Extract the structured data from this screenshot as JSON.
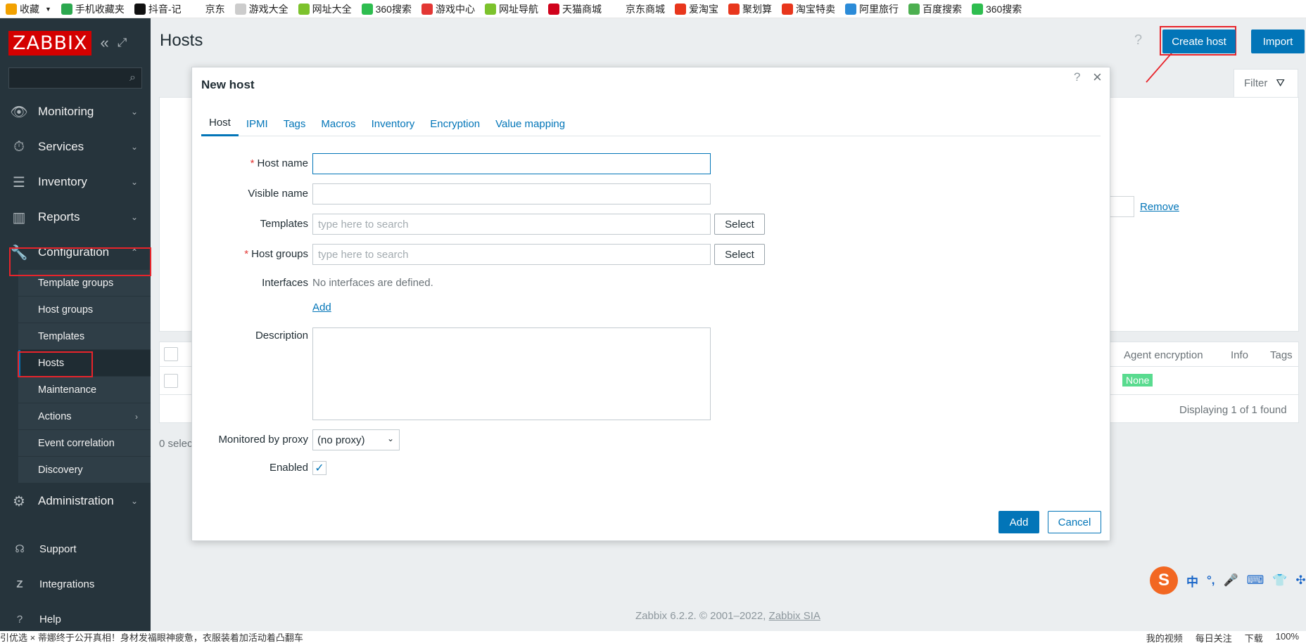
{
  "bookmarks": [
    {
      "label": "收藏",
      "icon": "star-icon",
      "color": "#f2a100"
    },
    {
      "label": "手机收藏夹",
      "icon": "phone-icon",
      "color": "#2ca84f"
    },
    {
      "label": "抖音-记",
      "icon": "tiktok-icon",
      "color": "#111111"
    },
    {
      "label": "京东",
      "icon": "jd-icon",
      "color": "#ffffff"
    },
    {
      "label": "游戏大全",
      "icon": "page-icon",
      "color": "#cccccc"
    },
    {
      "label": "网址大全",
      "icon": "plus-circle-icon",
      "color": "#7cc22c"
    },
    {
      "label": "360搜索",
      "icon": "ring-icon",
      "color": "#2ebd4f"
    },
    {
      "label": "游戏中心",
      "icon": "g-icon",
      "color": "#e33734"
    },
    {
      "label": "网址导航",
      "icon": "plus-circle-icon",
      "color": "#7cc22c"
    },
    {
      "label": "天猫商城",
      "icon": "tmall-icon",
      "color": "#d0021b"
    },
    {
      "label": "京东商城",
      "icon": "jd-icon",
      "color": "#ffffff"
    },
    {
      "label": "爱淘宝",
      "icon": "taobao-icon",
      "color": "#e8361c"
    },
    {
      "label": "聚划算",
      "icon": "juhuasuan-icon",
      "color": "#e8361c"
    },
    {
      "label": "淘宝特卖",
      "icon": "taobao-icon",
      "color": "#e8361c"
    },
    {
      "label": "阿里旅行",
      "icon": "travel-icon",
      "color": "#2b8bd8"
    },
    {
      "label": "百度搜索",
      "icon": "hao-icon",
      "color": "#4caf50"
    },
    {
      "label": "360搜索",
      "icon": "ring-icon",
      "color": "#2ebd4f"
    }
  ],
  "sidebar": {
    "logo": "ZABBIX",
    "menu": [
      {
        "label": "Monitoring",
        "icon": "eye-icon"
      },
      {
        "label": "Services",
        "icon": "stopwatch-icon"
      },
      {
        "label": "Inventory",
        "icon": "list-icon"
      },
      {
        "label": "Reports",
        "icon": "bar-chart-icon"
      },
      {
        "label": "Configuration",
        "icon": "wrench-icon"
      }
    ],
    "submenu": [
      "Template groups",
      "Host groups",
      "Templates",
      "Hosts",
      "Maintenance",
      "Actions",
      "Event correlation",
      "Discovery"
    ],
    "admin": {
      "label": "Administration",
      "icon": "gear-icon"
    },
    "bottom": [
      {
        "label": "Support",
        "icon": "headset-icon"
      },
      {
        "label": "Integrations",
        "icon": "z-icon"
      },
      {
        "label": "Help",
        "icon": "question-icon"
      }
    ]
  },
  "header": {
    "title": "Hosts",
    "help": "?",
    "create_host": "Create host",
    "import": "Import"
  },
  "filter": {
    "label": "Filter",
    "remove": "Remove"
  },
  "table": {
    "col_agent_encryption": "Agent encryption",
    "col_info": "Info",
    "col_tags": "Tags",
    "none_badge": "None",
    "displaying": "Displaying 1 of 1 found",
    "selected": "0 selec"
  },
  "footer": {
    "text": "Zabbix 6.2.2. © 2001–2022, ",
    "link": "Zabbix SIA"
  },
  "modal": {
    "title": "New host",
    "help": "?",
    "close": "×",
    "tabs": [
      "Host",
      "IPMI",
      "Tags",
      "Macros",
      "Inventory",
      "Encryption",
      "Value mapping"
    ],
    "host_name_label": "Host name",
    "visible_name_label": "Visible name",
    "templates_label": "Templates",
    "templates_placeholder": "type here to search",
    "host_groups_label": "Host groups",
    "host_groups_placeholder": "type here to search",
    "select_label": "Select",
    "interfaces_label": "Interfaces",
    "interfaces_value": "No interfaces are defined.",
    "add_link": "Add",
    "description_label": "Description",
    "proxy_label": "Monitored by proxy",
    "proxy_value": "(no proxy)",
    "enabled_label": "Enabled",
    "enabled_checked": true,
    "add_button": "Add",
    "cancel_button": "Cancel"
  },
  "ime": {
    "logo": "S",
    "items": [
      "中",
      "°,",
      "🎤",
      "⌨",
      "👕",
      "✣"
    ]
  },
  "statusbar": {
    "left": "引优选   ×  蒂娜终于公开真相！身材发福眼神疲惫，衣服装着加活动着凸翻车",
    "right": [
      "我的视频",
      "每日关注",
      "下载",
      "100%"
    ]
  },
  "colors": {
    "accent": "#0275b8",
    "sidebar_bg": "#26343c",
    "highlight": "#e8242b",
    "success": "#59db8f"
  }
}
